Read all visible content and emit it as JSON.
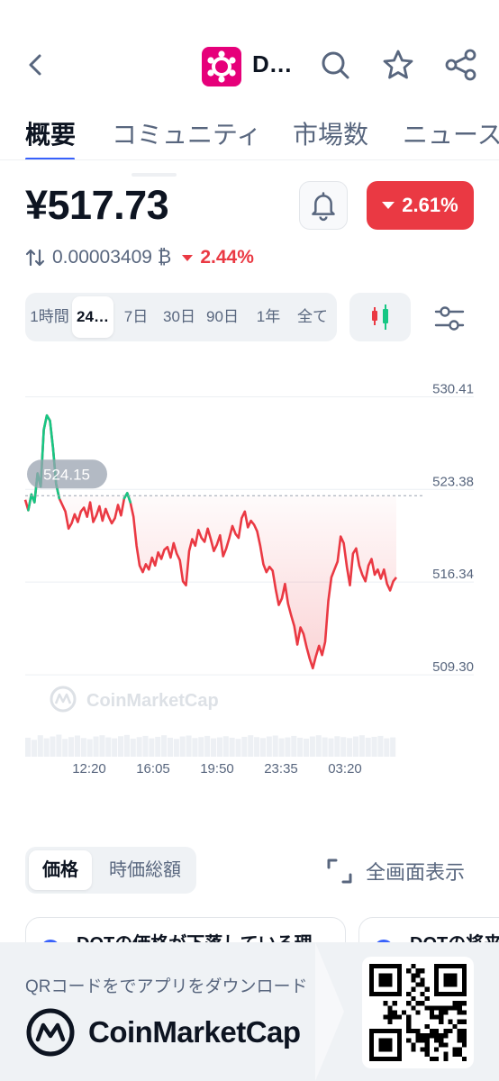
{
  "header": {
    "coin_abbr": "D...",
    "back_icon": "chevron-left-icon",
    "icons": [
      "search-icon",
      "star-icon",
      "share-icon"
    ],
    "brand_color": "#e6007a"
  },
  "tabs": [
    {
      "label": "概要",
      "active": true
    },
    {
      "label": "コミュニティ",
      "active": false
    },
    {
      "label": "市場数",
      "active": false
    },
    {
      "label": "ニュース",
      "active": false
    }
  ],
  "price": {
    "value": "¥517.73",
    "change_pct": "2.61%",
    "btc_value": "0.00003409 ₿",
    "btc_change_pct": "2.44%",
    "down_color": "#ea3943",
    "up_color": "#16c784"
  },
  "range_options": [
    {
      "label": "1時間",
      "active": false
    },
    {
      "label": "24…",
      "active": true
    },
    {
      "label": "7日",
      "active": false
    },
    {
      "label": "30日",
      "active": false
    },
    {
      "label": "90日",
      "active": false
    },
    {
      "label": "1年",
      "active": false
    },
    {
      "label": "全て",
      "active": false
    }
  ],
  "chart_data": {
    "type": "line",
    "y_ticks": [
      "530.41",
      "523.38",
      "516.34",
      "509.30"
    ],
    "ylim": [
      506.5,
      532.5
    ],
    "x_ticks": [
      "12:20",
      "16:05",
      "19:50",
      "23:35",
      "03:20"
    ],
    "reference_price_label": "524.15",
    "reference_price": 522.9,
    "watermark": "CoinMarketCap",
    "values": [
      522.6,
      521.8,
      523.0,
      522.4,
      524.6,
      523.6,
      527.9,
      529.0,
      528.6,
      526.5,
      523.8,
      522.7,
      522.2,
      521.7,
      520.4,
      520.8,
      521.5,
      520.9,
      521.7,
      522.0,
      521.3,
      522.4,
      520.9,
      521.4,
      522.1,
      521.0,
      521.9,
      521.3,
      520.8,
      521.2,
      522.2,
      521.4,
      522.7,
      523.1,
      522.4,
      521.3,
      519.1,
      517.6,
      517.1,
      517.7,
      517.3,
      518.2,
      517.6,
      518.6,
      518.1,
      518.8,
      519.0,
      518.2,
      519.3,
      518.5,
      518.0,
      516.4,
      516.1,
      518.7,
      519.6,
      519.1,
      520.3,
      519.7,
      519.4,
      520.4,
      519.6,
      518.7,
      519.2,
      519.9,
      518.3,
      518.9,
      519.7,
      520.6,
      520.0,
      519.7,
      521.2,
      521.7,
      520.5,
      521.0,
      520.7,
      520.2,
      519.1,
      517.7,
      517.1,
      517.5,
      517.2,
      515.8,
      514.6,
      515.1,
      516.2,
      514.7,
      513.8,
      513.0,
      511.6,
      512.9,
      512.4,
      511.4,
      510.5,
      509.8,
      510.7,
      511.5,
      510.8,
      511.8,
      514.9,
      516.7,
      517.3,
      517.9,
      519.8,
      519.3,
      517.5,
      516.1,
      518.5,
      518.9,
      517.6,
      516.9,
      516.4,
      517.6,
      518.1,
      516.9,
      517.3,
      516.6,
      517.3,
      516.2,
      515.7,
      516.4,
      516.7
    ],
    "volumes": [
      0.62,
      0.55,
      0.7,
      0.6,
      0.66,
      0.72,
      0.58,
      0.64,
      0.69,
      0.61,
      0.57,
      0.66,
      0.7,
      0.63,
      0.6,
      0.67,
      0.71,
      0.59,
      0.64,
      0.68,
      0.6,
      0.65,
      0.7,
      0.62,
      0.58,
      0.66,
      0.69,
      0.61,
      0.64,
      0.68,
      0.6,
      0.63,
      0.67,
      0.62,
      0.58,
      0.65,
      0.7,
      0.64,
      0.61,
      0.66,
      0.69,
      0.6,
      0.63,
      0.68,
      0.62,
      0.59,
      0.66,
      0.7,
      0.63,
      0.6,
      0.67,
      0.64,
      0.61,
      0.66,
      0.7,
      0.62,
      0.65,
      0.68,
      0.6,
      0.63
    ]
  },
  "price_toggle": [
    {
      "label": "価格",
      "active": true
    },
    {
      "label": "時価総額",
      "active": false
    }
  ],
  "fullscreen_label": "全画面表示",
  "news_cards": [
    {
      "title": "DOTの価格が下落している理"
    },
    {
      "title": "DOTの将来"
    }
  ],
  "banner": {
    "text": "QRコードをでアプリをダウンロード",
    "brand": "CoinMarketCap"
  }
}
